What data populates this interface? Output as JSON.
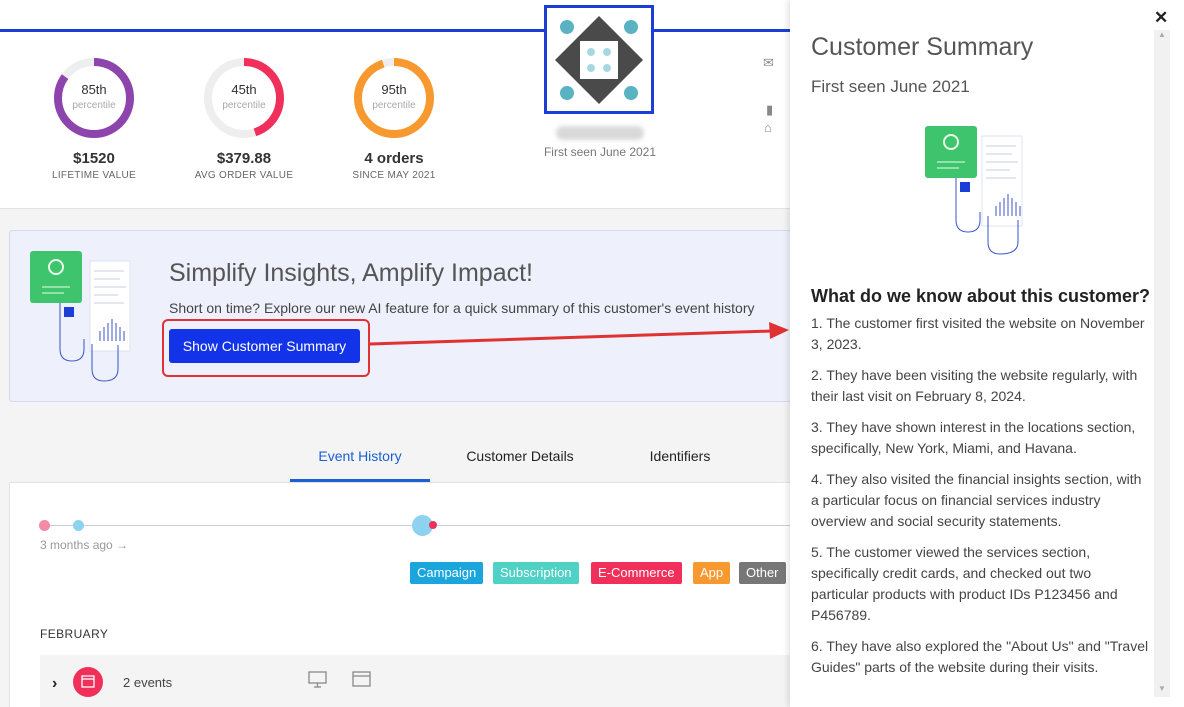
{
  "metrics": [
    {
      "percentile": "85th",
      "percentile_label": "percentile",
      "value": "$1520",
      "caption": "LIFETIME VALUE",
      "color": "#8e44ad",
      "fraction": 0.85
    },
    {
      "percentile": "45th",
      "percentile_label": "percentile",
      "value": "$379.88",
      "caption": "AVG ORDER VALUE",
      "color": "#f0305a",
      "fraction": 0.45
    },
    {
      "percentile": "95th",
      "percentile_label": "percentile",
      "value": "4 orders",
      "caption": "SINCE MAY 2021",
      "color": "#f7992f",
      "fraction": 0.95
    }
  ],
  "profile": {
    "first_seen": "First seen June 2021"
  },
  "banner": {
    "title": "Simplify Insights, Amplify Impact!",
    "subtitle": "Short on time? Explore our new AI feature for a quick summary of this customer's event history",
    "button_label": "Show Customer Summary"
  },
  "tabs": [
    {
      "label": "Event History",
      "active": true
    },
    {
      "label": "Customer Details",
      "active": false
    },
    {
      "label": "Identifiers",
      "active": false
    }
  ],
  "timeline": {
    "label": "3 months ago →"
  },
  "legend": [
    {
      "label": "Campaign",
      "color": "#1aa6dc"
    },
    {
      "label": "Subscription",
      "color": "#4fd1c5"
    },
    {
      "label": "E-Commerce",
      "color": "#f0305a"
    },
    {
      "label": "App",
      "color": "#f7992f"
    },
    {
      "label": "Other",
      "color": "#777777"
    }
  ],
  "events": {
    "month": "FEBRUARY",
    "count_label": "2 events"
  },
  "panel": {
    "close": "✕",
    "title": "Customer Summary",
    "subtitle": "First seen June 2021",
    "know_title": "What do we know about this customer?",
    "points": [
      "1. The customer first visited the website on November 3, 2023.",
      "2. They have been visiting the website regularly, with their last visit on February 8, 2024.",
      "3. They have shown interest in the locations section, specifically, New York, Miami, and Havana.",
      "4. They also visited the financial insights section, with a particular focus on financial services industry overview and social security statements.",
      "5. The customer viewed the services section, specifically credit cards, and checked out two particular products with product IDs P123456 and P456789.",
      "6. They have also explored the \"About Us\" and \"Travel Guides\" parts of the website during their visits."
    ]
  }
}
